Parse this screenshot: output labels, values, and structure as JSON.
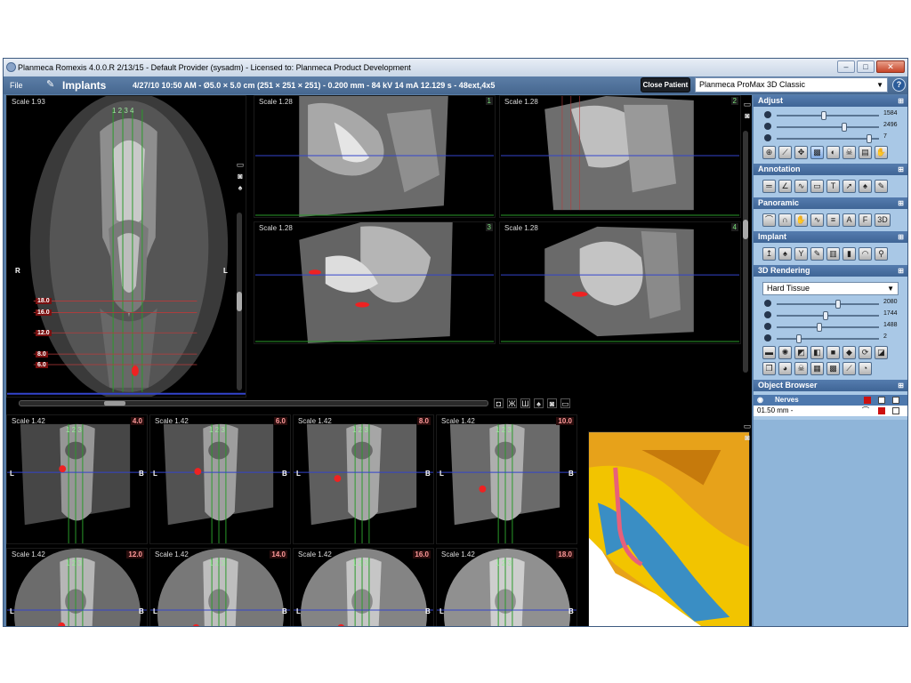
{
  "titlebar": {
    "title": "Planmeca Romexis 4.0.0.R  2/13/15 - Default Provider (sysadm) - Licensed to: Planmeca Product Development"
  },
  "toolbar": {
    "file_label": "File",
    "module_label": "Implants",
    "scan_info": "4/27/10 10:50 AM - Ø5.0 × 5.0 cm (251 × 251 × 251) - 0.200 mm - 84 kV 14 mA 12.129 s - 48ext,4x5",
    "close_patient_label": "Close Patient",
    "device_value": "Planmeca ProMax 3D Classic",
    "help_icon": "?"
  },
  "panoramic_view": {
    "scale": "Scale 1.93",
    "marker_numbers": "1 2 3 4",
    "left_label": "R",
    "right_label": "L",
    "ruler_values": [
      "18.0",
      "16.0",
      "12.0",
      "8.0",
      "6.0"
    ],
    "axis_ticks": [
      "4",
      "3",
      "2",
      "1"
    ]
  },
  "cross_views": [
    {
      "scale": "Scale 1.28",
      "number": "1"
    },
    {
      "scale": "Scale 1.28",
      "number": "2"
    },
    {
      "scale": "Scale 1.28",
      "number": "3"
    },
    {
      "scale": "Scale 1.28",
      "number": "4"
    }
  ],
  "slice_views": [
    {
      "scale": "Scale 1.42",
      "depth": "4.0"
    },
    {
      "scale": "Scale 1.42",
      "depth": "6.0"
    },
    {
      "scale": "Scale 1.42",
      "depth": "8.0"
    },
    {
      "scale": "Scale 1.42",
      "depth": "10.0"
    },
    {
      "scale": "Scale 1.42",
      "depth": "12.0"
    },
    {
      "scale": "Scale 1.42",
      "depth": "14.0"
    },
    {
      "scale": "Scale 1.42",
      "depth": "16.0"
    },
    {
      "scale": "Scale 1.42",
      "depth": "18.0"
    }
  ],
  "slice_labels": {
    "left": "L",
    "right": "B",
    "marks": "1 2 3"
  },
  "adjust": {
    "title": "Adjust",
    "sliders": [
      {
        "name": "contrast",
        "value": "1584",
        "pos": 0.45
      },
      {
        "name": "brightness",
        "value": "2496",
        "pos": 0.66
      },
      {
        "name": "gamma",
        "value": "7",
        "pos": 0.92
      }
    ],
    "tools": [
      "zoom-icon",
      "measure-icon",
      "pan-icon",
      "crop-icon",
      "panorama-icon",
      "skull-icon",
      "scan-icon",
      "hand-icon"
    ]
  },
  "annotation": {
    "title": "Annotation",
    "tools": [
      "line-icon",
      "angle-icon",
      "spline-icon",
      "area-icon",
      "text-icon",
      "arrow-icon",
      "tooth-icon",
      "pen-icon"
    ]
  },
  "panoramic": {
    "title": "Panoramic",
    "tools": [
      "curve-icon",
      "edit-curve-icon",
      "move-curve-icon",
      "nerve-icon",
      "slices-icon",
      "arch-a-icon",
      "arch-f-icon"
    ],
    "threed_label": "3D"
  },
  "implant": {
    "title": "Implant",
    "tools": [
      "add-implant-icon",
      "tooth-implant-icon",
      "bone-icon",
      "edit-implant-icon",
      "library-icon",
      "sleeve-icon",
      "crown-icon",
      "guide-icon"
    ]
  },
  "rendering": {
    "title": "3D Rendering",
    "preset": "Hard Tissue",
    "sliders": [
      {
        "name": "opacity",
        "value": "2080",
        "pos": 0.6
      },
      {
        "name": "light",
        "value": "1744",
        "pos": 0.47
      },
      {
        "name": "threshold",
        "value": "1488",
        "pos": 0.41
      },
      {
        "name": "detail",
        "value": "2",
        "pos": 0.2
      }
    ],
    "tools": [
      "dark-bg-icon",
      "light-icon",
      "clip-icon",
      "red-clip-icon",
      "green-clip-icon",
      "plane-icon",
      "rotate-icon",
      "reset-icon",
      "cube-icon",
      "head-icon",
      "skull-icon",
      "gallery-icon",
      "palette-icon",
      "ruler-icon",
      "skin-icon"
    ]
  },
  "object_browser": {
    "title": "Object Browser",
    "header_label": "Nerves",
    "row_label": "01.50 mm -"
  },
  "colors": {
    "accent": "#3f6596",
    "nerve": "#ee2222",
    "guide_line": "#2a9a2a",
    "axis_line": "#3344cc"
  }
}
